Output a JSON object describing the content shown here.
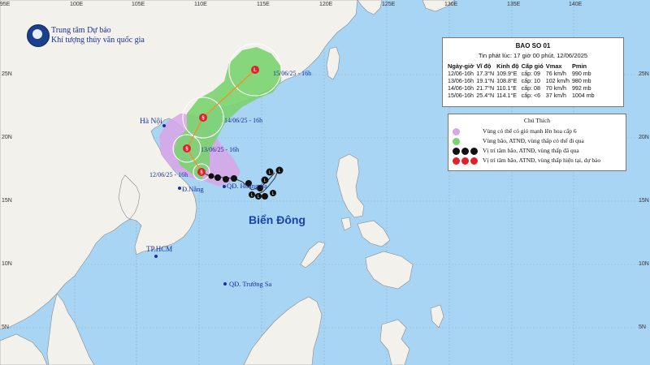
{
  "agency": {
    "line1": "Trung tâm Dự báo",
    "line2": "Khí tượng thủy văn quốc gia"
  },
  "grid": {
    "lon_labels": [
      "95E",
      "100E",
      "105E",
      "110E",
      "115E",
      "120E",
      "125E",
      "130E",
      "135E",
      "140E"
    ],
    "lat_labels": [
      "25N",
      "20N",
      "15N",
      "10N",
      "5N"
    ]
  },
  "bulletin": {
    "title": "BAO SO 01",
    "issued": "Tin phát lúc: 17 giờ 00 phút, 12/06/2025",
    "columns": [
      "Ngày-giờ",
      "Vĩ độ",
      "Kinh độ",
      "Cấp gió",
      "Vmax",
      "Pmin"
    ],
    "rows": [
      [
        "12/06-16h",
        "17.3°N",
        "109.9°E",
        "cấp: 09",
        "76 km/h",
        "990 mb"
      ],
      [
        "13/06-16h",
        "19.1°N",
        "108.8°E",
        "cấp: 10",
        "102 km/h",
        "980 mb"
      ],
      [
        "14/06-16h",
        "21.7°N",
        "110.1°E",
        "cấp: 08",
        "70 km/h",
        "992 mb"
      ],
      [
        "15/06-16h",
        "25.4°N",
        "114.1°E",
        "cấp: <6",
        "37 km/h",
        "1004 mb"
      ]
    ]
  },
  "legend": {
    "title": "Chú Thích",
    "items": [
      {
        "text": "Vùng có thể có gió mạnh lên hoa cấp 6",
        "color": "#d9a5e6"
      },
      {
        "text": "Vùng bão, ATNĐ, vùng thấp có thể đi qua",
        "color": "#7ad36f"
      },
      {
        "text": "Vị trí tâm bão, ATNĐ, vùng thấp đã qua",
        "color": "#111111"
      },
      {
        "text": "Vị trí tâm bão, ATNĐ, vùng thấp hiện tại, dự báo",
        "color": "#e0202a"
      }
    ]
  },
  "places": {
    "hanoi": "Hà Nội",
    "danang": "Đ.Nẵng",
    "hoangsa": "QĐ. Hoàng Sa",
    "hcm": "TP.HCM",
    "truongsa": "QĐ. Trường Sa",
    "sea": "Biển Đông"
  },
  "track_labels": {
    "p1": "12/06/25 - 16h",
    "p2": "13/06/25 - 16h",
    "p3": "14/06/25 - 16h",
    "p4": "15/06/25 - 16h"
  },
  "colors": {
    "sea": "#a9d5f4",
    "land": "#f2f1ec",
    "cone_green": "#7ad36f",
    "wind_purple": "#d9a5e6",
    "storm_red": "#e0202a",
    "track_orange": "#ff8a1e",
    "label_blue": "#1a2f9a"
  }
}
